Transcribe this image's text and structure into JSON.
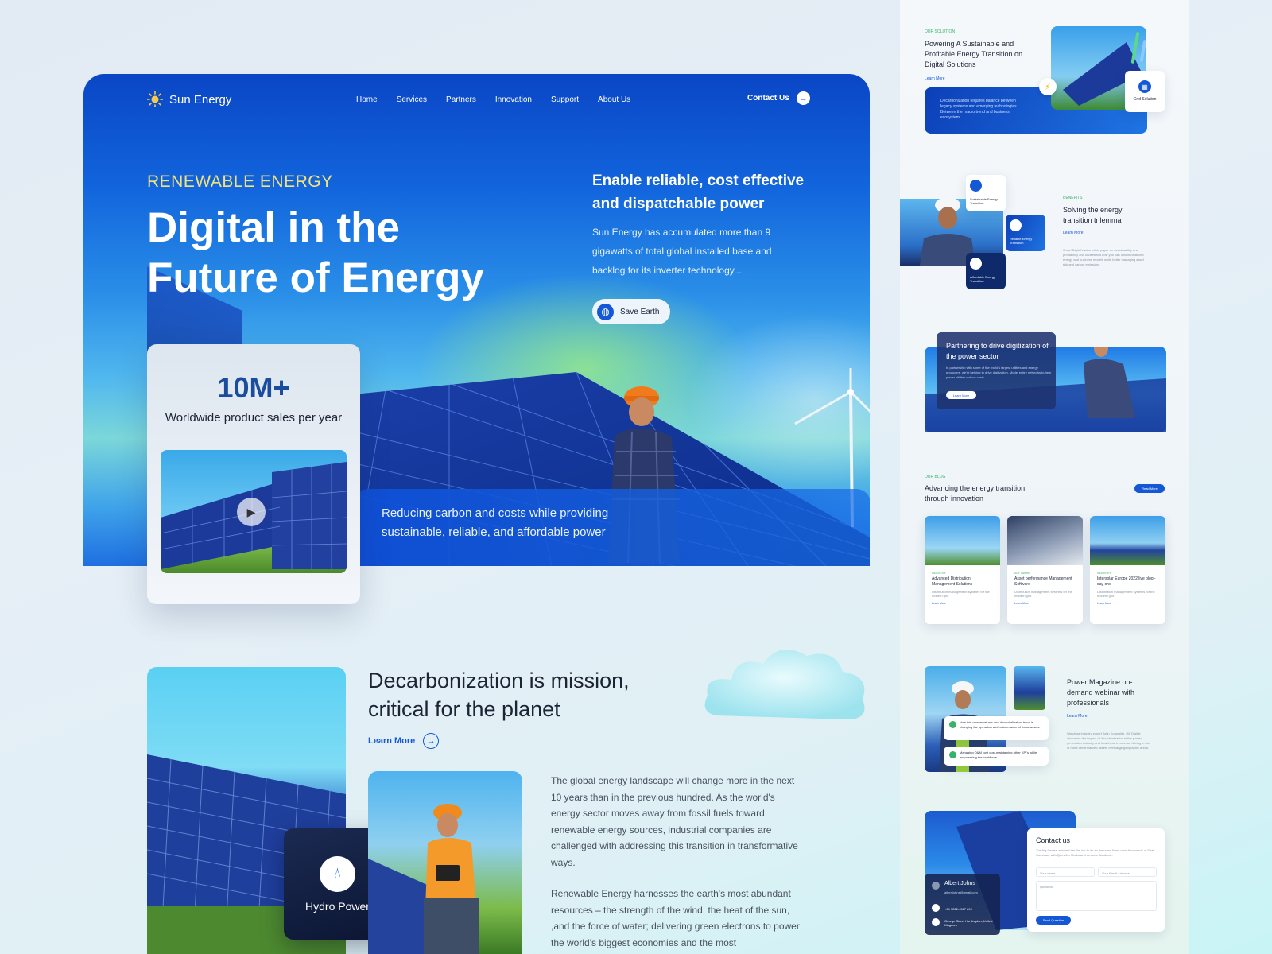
{
  "brand": {
    "name": "Sun Energy"
  },
  "nav": {
    "items": [
      {
        "label": "Home"
      },
      {
        "label": "Services"
      },
      {
        "label": "Partners"
      },
      {
        "label": "Innovation"
      },
      {
        "label": "Support"
      },
      {
        "label": "About Us"
      }
    ],
    "contact_label": "Contact Us"
  },
  "hero": {
    "eyebrow": "RENEWABLE ENERGY",
    "title": "Digital in the Future of Energy",
    "side_heading": "Enable reliable, cost effective and dispatchable power",
    "side_text": "Sun Energy has accumulated more than 9 gigawatts of total global installed base and backlog for its inverter technology...",
    "save_label": "Save Earth",
    "band_text": "Reducing carbon and costs while providing sustainable, reliable, and affordable power"
  },
  "stat": {
    "value": "10M+",
    "label": "Worldwide product sales per year"
  },
  "mission": {
    "title": "Decarbonization is mission, critical for the planet",
    "learn_more": "Learn More",
    "hydro_label": "Hydro Power",
    "para1": "The global energy landscape will change more in the next 10 years than in the previous hundred. As the world's energy sector moves away from fossil fuels toward renewable energy sources, industrial companies are challenged with addressing this transition in transformative ways.",
    "para2": "Renewable Energy harnesses the earth's most abundant resources – the strength of the wind, the heat of the sun, ,and the force of water; delivering green electrons to power the world's biggest economies and the most"
  },
  "preview": {
    "solution": {
      "tag": "OUR SOLUTION",
      "title": "Powering A Sustainable and Profitable Energy Transition on Digital Solutions",
      "learn": "Learn More",
      "card_text": "Decarbonization requires balance between legacy systems and emerging technologies. Between the macro trend and business ecosystem.",
      "grid_label": "Grid Solution"
    },
    "benefits": {
      "tag": "BENEFITS",
      "title": "Solving the energy transition trilemma",
      "learn": "Learn More",
      "text": "Smart Digital's wins within paper on sustainability and profitability and understand how you can unlock balanced energy and business models while better managing asset risk and carbon emissions.",
      "chips": [
        "Sustainable Energy Transition",
        "Reliable Energy Transition",
        "Affordable Energy Transition"
      ]
    },
    "partner": {
      "title": "Partnering to drive digitization of the power sector",
      "text": "In partnership with some of the world's largest utilities and energy producers, we're helping to drive digitization. Model entire networks to help power utilities reduce costs.",
      "btn": "Learn More"
    },
    "blog": {
      "tag": "OUR BLOG",
      "title": "Advancing the energy transition through innovation",
      "btn": "Read More",
      "cards": [
        {
          "tag": "INDUSTRY",
          "title": "Advanced Distribution Management Solutions",
          "text": "Distribution management systems for the modern grid",
          "link": "Learn More"
        },
        {
          "tag": "SOFTWARE",
          "title": "Asset performance Management Software",
          "text": "Distribution management systems for the modern grid",
          "link": "Learn More"
        },
        {
          "tag": "INDUSTRY",
          "title": "Intersolar Europe 2022 live blog - day one",
          "text": "Distribution management systems for the modern grid",
          "link": "Learn More"
        }
      ]
    },
    "webinar": {
      "title": "Power Magazine on-demand webinar with professionals",
      "learn": "Learn More",
      "text": "Watch as industry expert John Konwaldz, GE Digital discusses the impact of decarbonization in the power generation industry and how these trends are driving a mix of more decentralized assets over large geographic areas.",
      "q1": "How this new asset mix and decentralization trend is changing the operation and maintenance of these assets",
      "q2": "Managing O&M cost cost-maintaining other KPI's while empowering the workforce"
    },
    "contact": {
      "title": "Contact us",
      "text": "The big Denise admired her the inn to do so, because there were thousands of Seal Cumbrae, with Question Marks and devious Sandrock.",
      "name_ph": "Your name",
      "email_ph": "Your Email Address",
      "question_ph": "Question",
      "send": "Send Question",
      "person": "Albert Johns",
      "email": "albertjohns@gmail.com",
      "phone": "+64 1222-4567 890",
      "address": "George Street Huntingdon, United Kingdom"
    }
  },
  "colors": {
    "primary": "#1558d6",
    "dark": "#1d2435",
    "accent_yellow": "#f3e27a",
    "green": "#38b36a"
  },
  "icons": [
    "sun-icon",
    "arrow-right-icon",
    "globe-icon",
    "play-icon",
    "water-drop-icon",
    "grid-icon",
    "bolt-icon",
    "user-icon",
    "phone-icon",
    "location-icon"
  ]
}
